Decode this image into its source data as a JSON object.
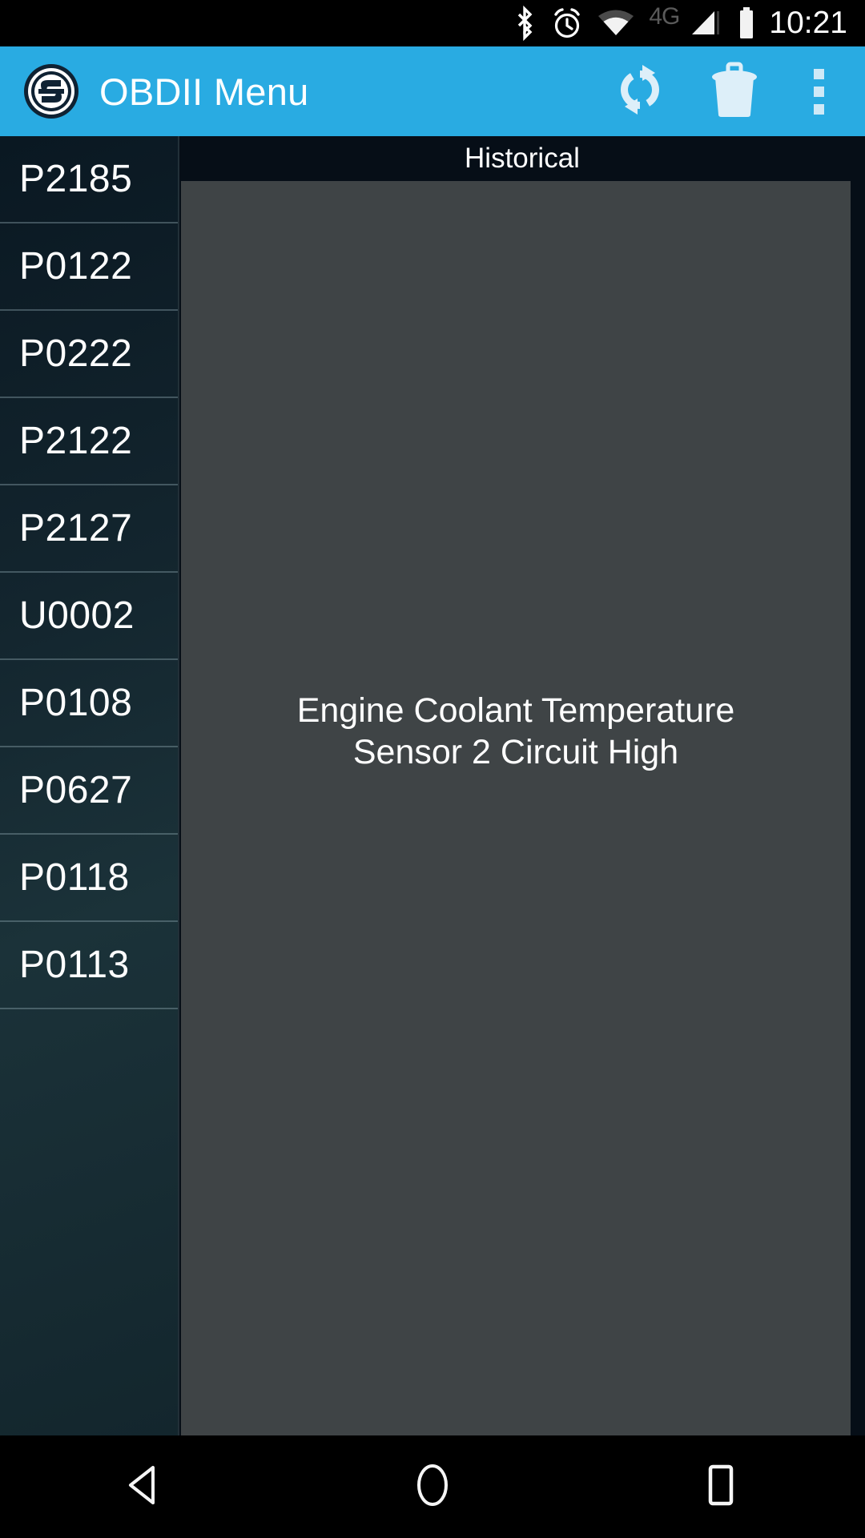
{
  "status_bar": {
    "icons": [
      "bluetooth-icon",
      "alarm-icon",
      "wifi-icon",
      "signal-icon",
      "battery-icon"
    ],
    "network_label": "4G",
    "time": "10:21"
  },
  "app_bar": {
    "logo_icon": "app-logo-s-badge-icon",
    "title": "OBDII Menu",
    "actions": [
      {
        "name": "refresh",
        "icon": "refresh-sync-icon"
      },
      {
        "name": "delete",
        "icon": "trash-can-icon"
      }
    ],
    "overflow_icon": "overflow-menu-icon",
    "background_color": "#29ABE2",
    "title_color": "#FFFFFF"
  },
  "dtc_list": {
    "items": [
      {
        "code": "P2185"
      },
      {
        "code": "P0122"
      },
      {
        "code": "P0222"
      },
      {
        "code": "P2122"
      },
      {
        "code": "P2127"
      },
      {
        "code": "U0002"
      },
      {
        "code": "P0108"
      },
      {
        "code": "P0627"
      },
      {
        "code": "P0118"
      },
      {
        "code": "P0113"
      }
    ]
  },
  "detail": {
    "header_title": "Historical",
    "description": "Engine Coolant Temperature Sensor 2 Circuit High",
    "card_color": "#3F4446"
  },
  "nav_bar": {
    "buttons": [
      {
        "name": "back",
        "icon": "back-triangle-icon"
      },
      {
        "name": "home",
        "icon": "home-circle-icon"
      },
      {
        "name": "recents",
        "icon": "recents-square-icon"
      }
    ]
  }
}
